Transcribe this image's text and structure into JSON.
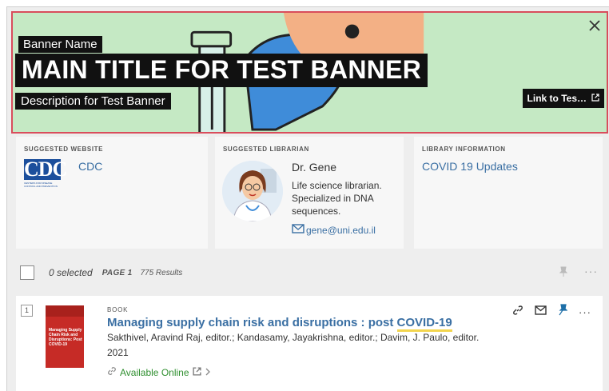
{
  "banner": {
    "name": "Banner Name",
    "title": "MAIN TITLE FOR TEST BANNER",
    "description": "Description for Test Banner",
    "link_label": "Link to Tes…",
    "close_icon": "close-icon",
    "border_color": "#d94d5c",
    "background_color": "#c5e9c4"
  },
  "cards": {
    "website": {
      "label": "SUGGESTED WEBSITE",
      "logo_text": "CDC",
      "logo_sub": "CENTERS FOR DISEASE CONTROL AND PREVENTION",
      "link": "CDC"
    },
    "librarian": {
      "label": "SUGGESTED LIBRARIAN",
      "name": "Dr. Gene",
      "description": "Life science librarian. Specialized in DNA sequences.",
      "email": "gene@uni.edu.il"
    },
    "info": {
      "label": "LIBRARY INFORMATION",
      "link": "COVID 19 Updates"
    }
  },
  "toolbar": {
    "selected": "0 selected",
    "page": "PAGE 1",
    "results": "775 Results"
  },
  "result": {
    "number": "1",
    "type": "BOOK",
    "title_before": "Managing supply chain risk and disruptions : post ",
    "title_highlight": "COVID-19",
    "authors": "Sakthivel, Aravind Raj, editor.; Kandasamy, Jayakrishna, editor.; Davim, J. Paulo, editor.",
    "year": "2021",
    "availability": "Available Online",
    "cover_title": "Managing Supply Chain Risk and Disruptions: Post COVID-19",
    "cover_color": "#c62b26"
  },
  "colors": {
    "link": "#3a6fa3",
    "available": "#2f8f2f",
    "highlight": "#f3d54e"
  }
}
